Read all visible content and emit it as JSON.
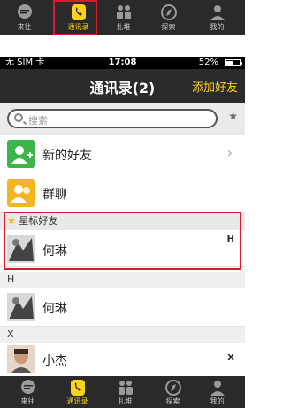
{
  "tabs": [
    {
      "label": "来往",
      "icon": "chat-icon"
    },
    {
      "label": "通讯录",
      "icon": "phone-icon",
      "active": true
    },
    {
      "label": "扎堆",
      "icon": "group-icon"
    },
    {
      "label": "探索",
      "icon": "compass-icon"
    },
    {
      "label": "我的",
      "icon": "person-icon"
    }
  ],
  "status": {
    "carrier": "无 SIM 卡",
    "time": "17:08",
    "battery": "52%"
  },
  "nav": {
    "title": "通讯录(2)",
    "action": "添加好友"
  },
  "search": {
    "placeholder": "搜索"
  },
  "rows": {
    "new_friends": "新的好友",
    "group_chat": "群聊",
    "starred_header": "星标好友",
    "starred_contact": "何琳",
    "starred_index": "H",
    "section_h": "H",
    "contact_h": "何琳",
    "section_x": "X",
    "contact_x": "小杰",
    "x_index": "X"
  },
  "colors": {
    "accent": "#ffd21a",
    "highlight": "#e0182b",
    "bar": "#2a2a2a"
  }
}
